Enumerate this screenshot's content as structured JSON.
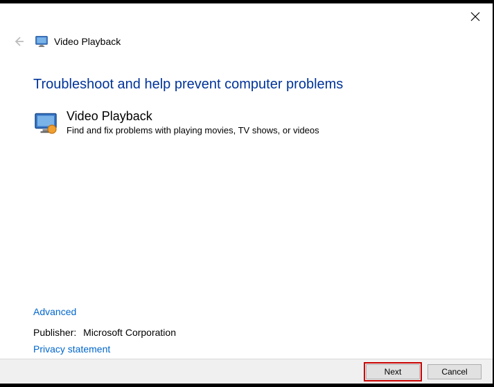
{
  "titlebar": {
    "close_label": "Close"
  },
  "header": {
    "back_label": "Back",
    "icon": "monitor-playback-icon",
    "title": "Video Playback"
  },
  "content": {
    "heading": "Troubleshoot and help prevent computer problems",
    "item": {
      "icon": "monitor-playback-icon",
      "title": "Video Playback",
      "description": "Find and fix problems with playing movies, TV shows, or videos"
    }
  },
  "links": {
    "advanced": "Advanced",
    "privacy": "Privacy statement"
  },
  "publisher": {
    "label": "Publisher:",
    "value": "Microsoft Corporation"
  },
  "buttons": {
    "next": "Next",
    "cancel": "Cancel"
  }
}
